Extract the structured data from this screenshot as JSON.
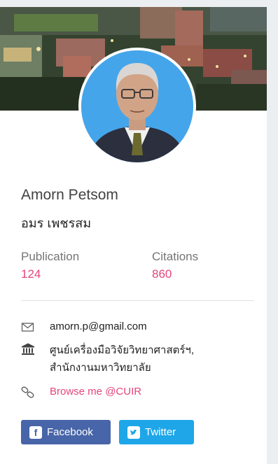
{
  "profile": {
    "name_en": "Amorn Petsom",
    "name_th": "อมร เพชรสม"
  },
  "stats": {
    "publication_label": "Publication",
    "publication_value": "124",
    "citations_label": "Citations",
    "citations_value": "860"
  },
  "contact": {
    "email": "amorn.p@gmail.com",
    "institution_line1": "ศูนย์เครื่องมือวิจัยวิทยาศาสตร์ฯ,",
    "institution_line2": "สำนักงานมหาวิทยาลัย",
    "link_text": "Browse me @CUIR"
  },
  "social": {
    "facebook_label": "Facebook",
    "twitter_label": "Twitter"
  },
  "icons": {
    "email": "envelope-icon",
    "institution": "bank-icon",
    "link": "chain-link-icon",
    "facebook": "facebook-icon",
    "twitter": "twitter-icon"
  },
  "colors": {
    "accent": "#e5467a",
    "facebook": "#4765a8",
    "twitter": "#1ea6e8"
  }
}
